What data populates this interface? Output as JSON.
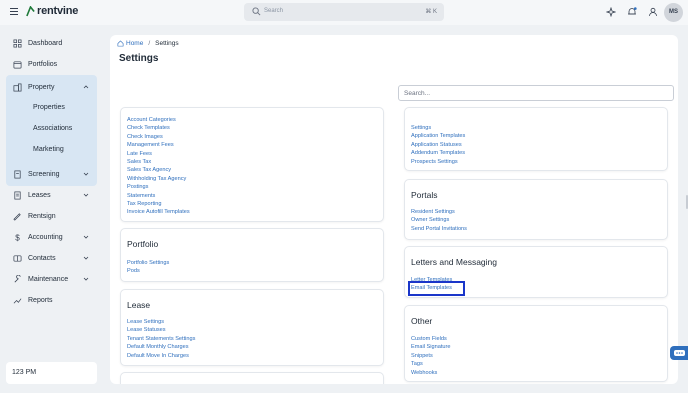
{
  "topbar": {
    "logo_text": "rentvine",
    "search_placeholder": "Search",
    "search_shortcut": "⌘ K",
    "avatar_initials": "MS",
    "icons": [
      "sparkle-icon",
      "bell-icon",
      "user-icon"
    ]
  },
  "sidebar": {
    "items": [
      {
        "label": "Dashboard",
        "icon": "dashboard-icon"
      },
      {
        "label": "Portfolios",
        "icon": "portfolio-icon"
      },
      {
        "label": "Property",
        "icon": "building-icon",
        "expanded": true
      },
      {
        "label": "Screening",
        "icon": "screening-icon"
      },
      {
        "label": "Leases",
        "icon": "lease-icon"
      },
      {
        "label": "Rentsign",
        "icon": "sign-icon"
      },
      {
        "label": "Accounting",
        "icon": "dollar-icon"
      },
      {
        "label": "Contacts",
        "icon": "contacts-icon"
      },
      {
        "label": "Maintenance",
        "icon": "wrench-icon"
      },
      {
        "label": "Reports",
        "icon": "reports-icon"
      }
    ],
    "property_sub": [
      "Properties",
      "Associations",
      "Marketing"
    ],
    "clock": "123 PM"
  },
  "main": {
    "breadcrumb": {
      "home": "Home",
      "current": "Settings"
    },
    "title": "Settings",
    "search_placeholder": "Search...",
    "cards": {
      "accounting": {
        "links": [
          "Account Categories",
          "Check Templates",
          "Check Images",
          "Management Fees",
          "Late Fees",
          "Sales Tax",
          "Sales Tax Agency",
          "Withholding Tax Agency",
          "Postings",
          "Statements",
          "Tax Reporting",
          "Invoice Autofill Templates"
        ]
      },
      "screening": {
        "links": [
          "Settings",
          "Application Templates",
          "Application Statuses",
          "Addendum Templates",
          "Prospects Settings"
        ]
      },
      "portfolio": {
        "title": "Portfolio",
        "links": [
          "Portfolio Settings",
          "Pods"
        ]
      },
      "portals": {
        "title": "Portals",
        "links": [
          "Resident Settings",
          "Owner Settings",
          "Send Portal Invitations"
        ]
      },
      "lease": {
        "title": "Lease",
        "links": [
          "Lease Settings",
          "Lease Statuses",
          "Tenant Statements Settings",
          "Default Monthly Charges",
          "Default Move In Charges"
        ]
      },
      "letters": {
        "title": "Letters and Messaging",
        "links": [
          "Letter Templates",
          "Email Templates"
        ]
      },
      "other": {
        "title": "Other",
        "links": [
          "Custom Fields",
          "Email Signature",
          "Snippets",
          "Tags",
          "Webhooks"
        ]
      }
    }
  },
  "colors": {
    "accent": "#2f6fbd",
    "sidebar_active": "#d8e6f3",
    "highlight": "#1a36c9",
    "background": "#eef1f4"
  }
}
